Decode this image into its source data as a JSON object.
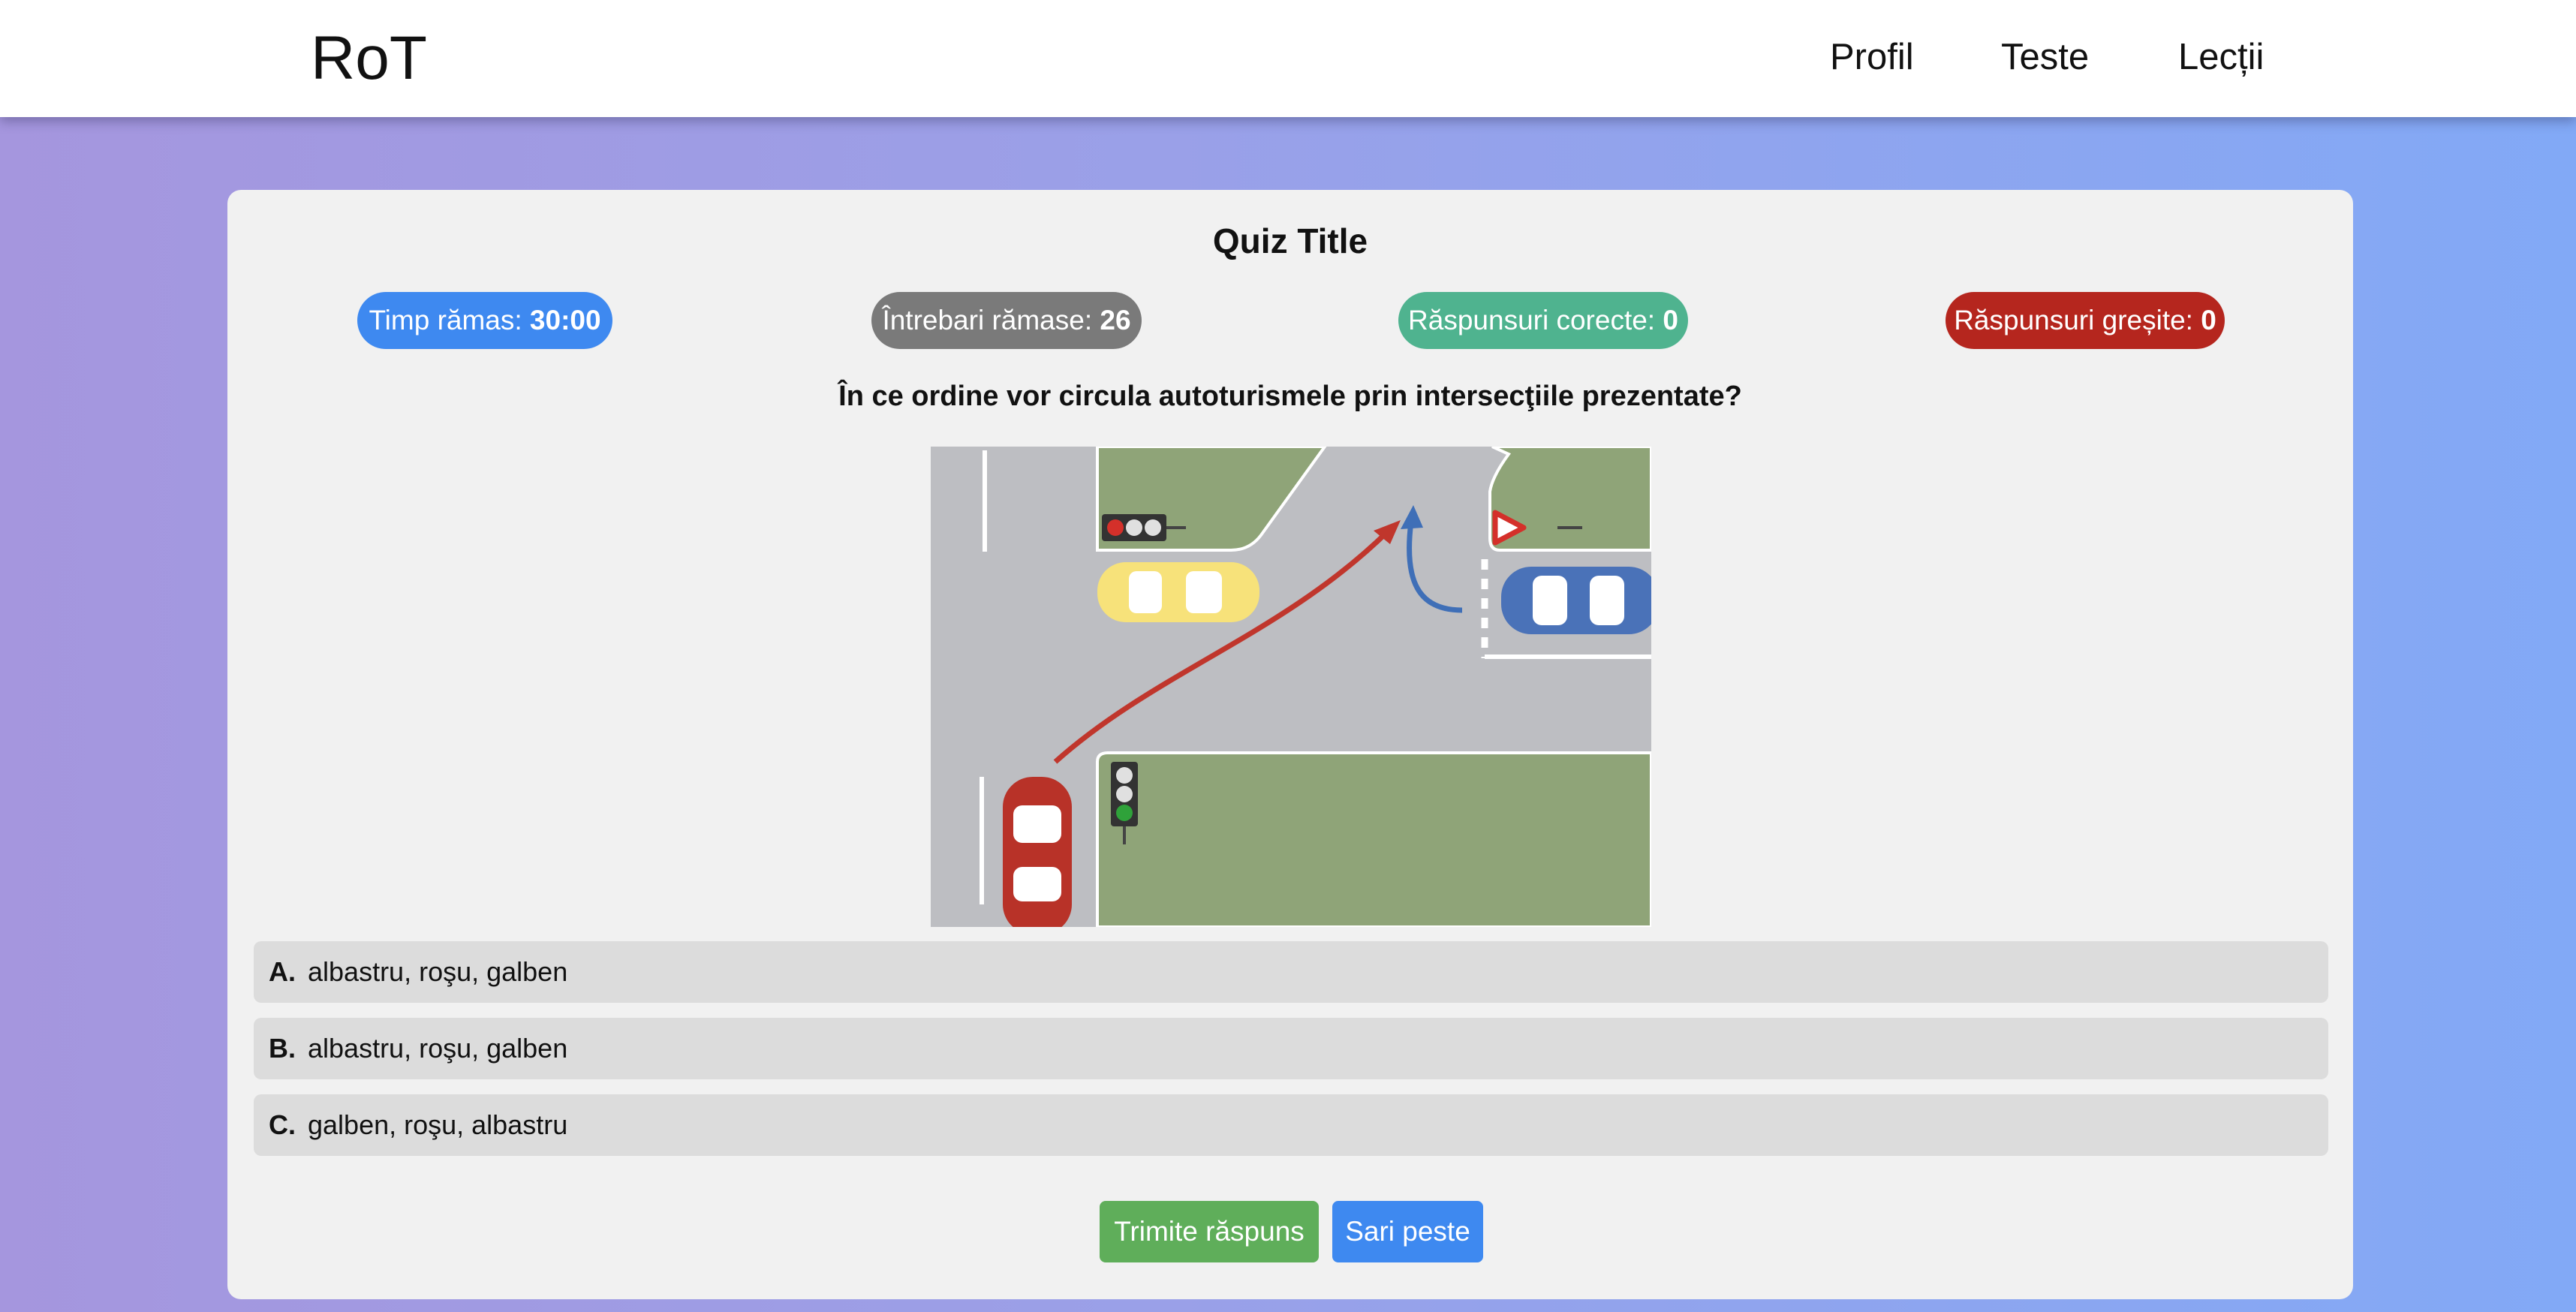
{
  "nav": {
    "brand": "RoT",
    "links": [
      "Profil",
      "Teste",
      "Lecții"
    ]
  },
  "quiz": {
    "title": "Quiz Title",
    "stats": {
      "time": {
        "label": "Timp rămas: ",
        "value": "30:00",
        "color": "#3e89f0"
      },
      "remaining": {
        "label": "Întrebari rămase: ",
        "value": "26",
        "color": "#7a7a7a"
      },
      "correct": {
        "label": "Răspunsuri corecte: ",
        "value": "0",
        "color": "#4fb38f"
      },
      "wrong": {
        "label": "Răspunsuri greșite: ",
        "value": "0",
        "color": "#b5261e"
      }
    },
    "question": "În ce ordine vor circula autoturismele prin intersecţiile prezentate?",
    "answers": [
      {
        "letter": "A.",
        "text": "albastru, roşu, galben"
      },
      {
        "letter": "B.",
        "text": "albastru, roşu, galben"
      },
      {
        "letter": "C.",
        "text": "galben, roşu, albastru"
      }
    ],
    "buttons": {
      "submit": {
        "label": "Trimite răspuns",
        "color": "#5fae5a"
      },
      "skip": {
        "label": "Sari peste",
        "color": "#3e89f0"
      }
    }
  },
  "illustration": {
    "cars": [
      "yellow-car",
      "blue-car",
      "red-car"
    ],
    "colors": {
      "road": "#bdbec2",
      "grass": "#8fa478",
      "yellow_car": "#f7e27a",
      "blue_car": "#4a72b8",
      "red_car": "#b83228",
      "red_arrow": "#c0362c",
      "blue_arrow": "#3f6fb7"
    }
  }
}
